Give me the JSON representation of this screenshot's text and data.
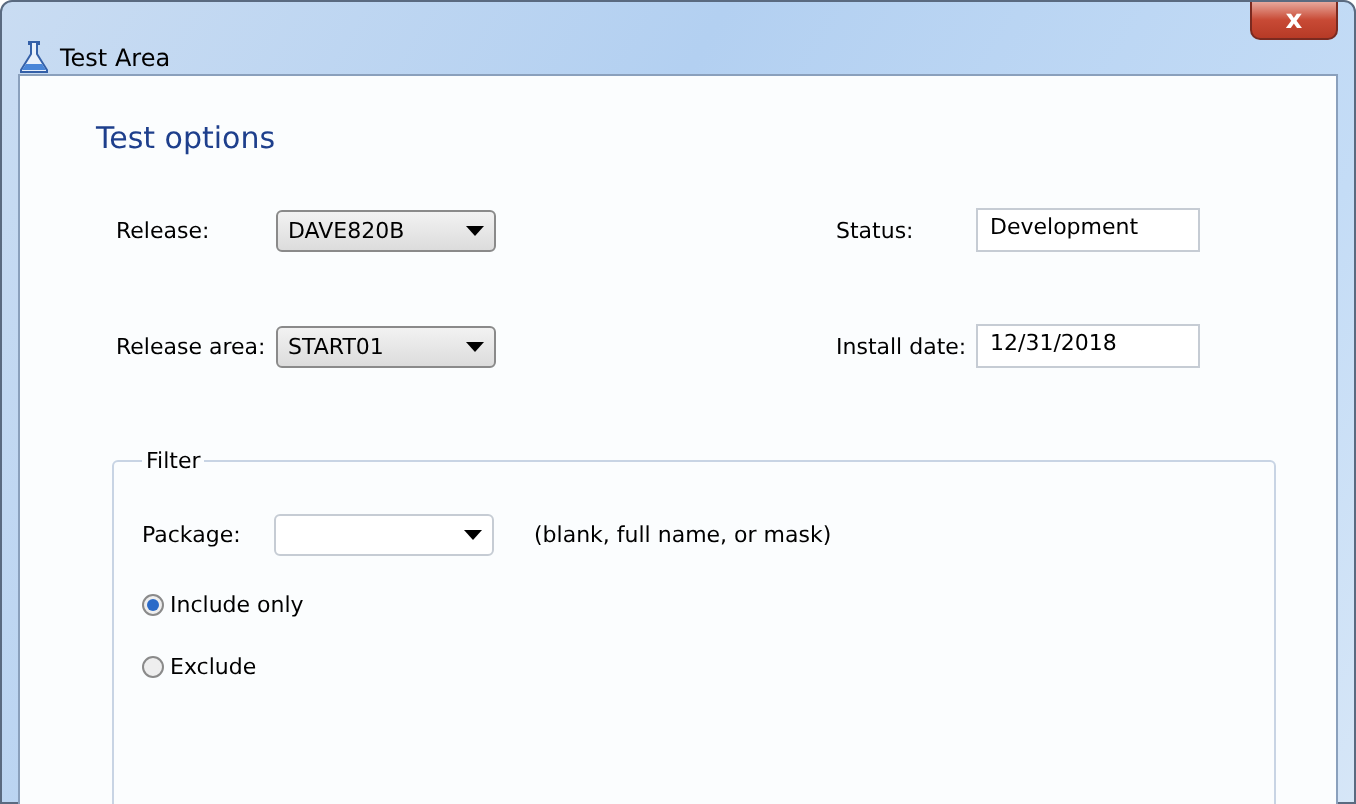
{
  "window": {
    "title": "Test Area",
    "close": "x"
  },
  "heading": "Test options",
  "fields": [
    {
      "kind": "dropdown",
      "label": "Release:",
      "value": "DAVE820B"
    },
    {
      "kind": "text",
      "label": "Status:",
      "value": "Development"
    },
    {
      "kind": "dropdown",
      "label": "Release area:",
      "value": "START01"
    },
    {
      "kind": "text",
      "label": "Install date:",
      "value": "12/31/2018"
    }
  ],
  "filter": {
    "title": "Filter",
    "package": {
      "label": "Package:",
      "hint": "(blank, full name, or mask)"
    },
    "options": [
      {
        "label": "Include only",
        "selected": true
      },
      {
        "label": "Exclude",
        "selected": false
      }
    ]
  }
}
